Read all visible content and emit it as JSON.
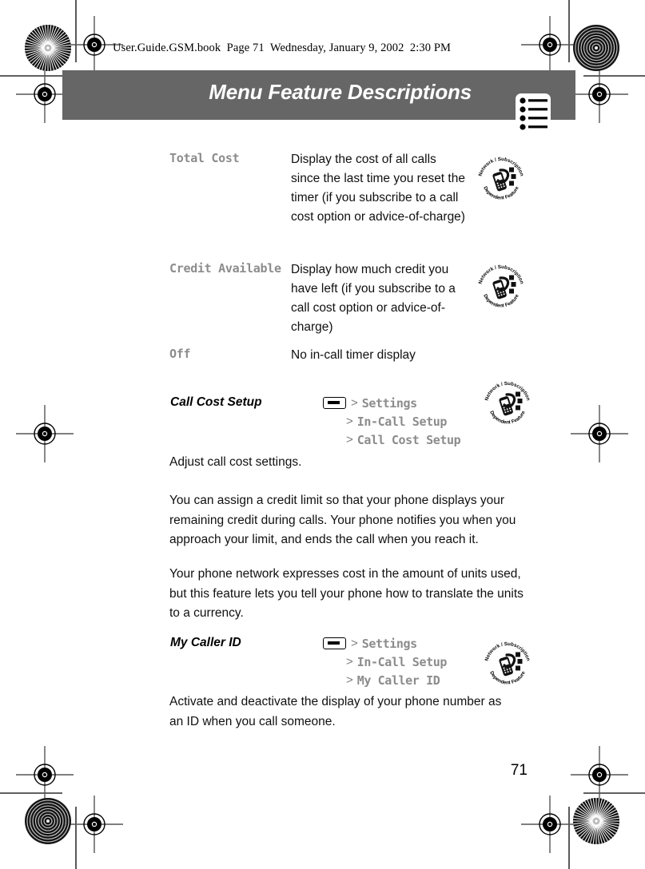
{
  "document": {
    "filename_line": "User.Guide.GSM.book  Page 71  Wednesday, January 9, 2002  2:30 PM",
    "chapter_title": "Menu Feature Descriptions",
    "page_number": "71",
    "chapter_icon": "menu-list-icon",
    "badge_label_top": "Network / Subscription",
    "badge_label_bottom": "Dependent Feature",
    "accent_gray": "#666666",
    "term_gray": "#8c8c8c"
  },
  "option_table": {
    "rows": [
      {
        "term": "Total Cost",
        "description": "Display the cost of all calls since the last time you reset the timer (if you subscribe to a call cost option or advice-of-charge)",
        "has_badge": true
      },
      {
        "term": "Credit Available",
        "description": "Display how much credit you have left (if you subscribe to a call cost option or advice-of-charge)",
        "has_badge": true
      },
      {
        "term": "Off",
        "description": "No in-call timer display",
        "has_badge": false
      }
    ]
  },
  "features": [
    {
      "name": "Call Cost Setup",
      "menu_key_icon": "menu-key-icon",
      "path": [
        "Settings",
        "In-Call Setup",
        "Call Cost Setup"
      ],
      "separator": ">",
      "has_badge": true,
      "paragraphs": [
        "Adjust call cost settings.",
        "You can assign a credit limit so that your phone displays your remaining credit during calls. Your phone notifies you when you approach your limit, and ends the call when you reach it.",
        "Your phone network expresses cost in the amount of units used, but this feature lets you tell your phone how to translate the units to a currency."
      ]
    },
    {
      "name": "My Caller ID",
      "menu_key_icon": "menu-key-icon",
      "path": [
        "Settings",
        "In-Call Setup",
        "My Caller ID"
      ],
      "separator": ">",
      "has_badge": true,
      "paragraphs": [
        "Activate and deactivate the display of your phone number as an ID when you call someone."
      ]
    }
  ]
}
